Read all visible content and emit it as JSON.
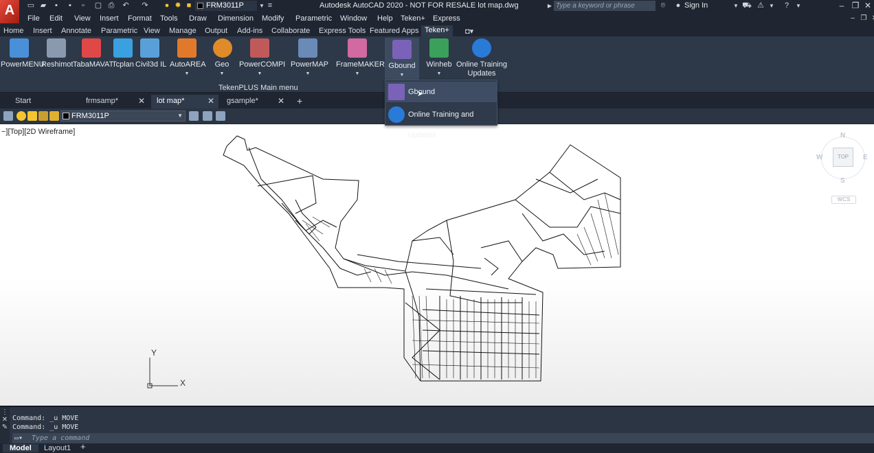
{
  "titlebar": {
    "app_logo": "A",
    "layer_name": "FRM3011P",
    "title": "Autodesk AutoCAD 2020 - NOT FOR RESALE   lot map.dwg",
    "search_placeholder": "Type a keyword or phrase",
    "sign_in": "Sign In"
  },
  "menubar": [
    "File",
    "Edit",
    "View",
    "Insert",
    "Format",
    "Tools",
    "Draw",
    "Dimension",
    "Modify",
    "Parametric",
    "Window",
    "Help",
    "Teken+",
    "Express"
  ],
  "ribbon_tabs": [
    "Home",
    "Insert",
    "Annotate",
    "Parametric",
    "View",
    "Manage",
    "Output",
    "Add-ins",
    "Collaborate",
    "Express Tools",
    "Featured Apps",
    "Teken+"
  ],
  "ribbon": {
    "buttons": [
      {
        "label": "PowerMENU",
        "color": "#4a90d9"
      },
      {
        "label": "Reshimot",
        "color": "#8a9aae"
      },
      {
        "label": "TabaMAVAT",
        "color": "#e04848"
      },
      {
        "label": "Tcplan",
        "color": "#3aa0e0"
      },
      {
        "label": "Civil3d IL",
        "color": "#5aa0d8"
      },
      {
        "label": "AutoAREA",
        "color": "#e07a2a"
      },
      {
        "label": "Geo",
        "color": "#e08a2a"
      },
      {
        "label": "PowerCOMPI",
        "color": "#c05a5a"
      },
      {
        "label": "PowerMAP",
        "color": "#6a8ab8"
      },
      {
        "label": "FrameMAKER",
        "color": "#d06aa0"
      },
      {
        "label": "Gbound",
        "color": "#7a62b8"
      },
      {
        "label": "Winheb",
        "color": "#3aa05a"
      },
      {
        "label": "Online Training",
        "label2": "Updates",
        "color": "#2a7ad8"
      }
    ],
    "panel_title": "TekenPLUS Main menu"
  },
  "doc_tabs": [
    {
      "label": "Start",
      "close": false
    },
    {
      "label": "frmsamp*",
      "close": true
    },
    {
      "label": "lot map*",
      "close": true,
      "active": true
    },
    {
      "label": "gsample*",
      "close": true
    }
  ],
  "layer_toolbar": {
    "current_layer": "FRM3011P"
  },
  "viewport": {
    "label": "−][Top][2D Wireframe]",
    "viewcube": {
      "n": "N",
      "s": "S",
      "e": "E",
      "w": "W",
      "top": "TOP",
      "wcs": "WCS"
    },
    "ucs": {
      "x": "X",
      "y": "Y"
    }
  },
  "dropdown": {
    "items": [
      {
        "label": "Gbound"
      },
      {
        "label": "Online Training and Updates"
      }
    ]
  },
  "command": {
    "history": [
      "Command: _u MOVE",
      "Command: _u MOVE"
    ],
    "placeholder": "Type a command"
  },
  "status": {
    "tabs": [
      "Model",
      "Layout1"
    ]
  },
  "colors": {
    "accent": "#2f3a4b",
    "ribbon": "#2d3848",
    "logo": "#c4291b"
  }
}
